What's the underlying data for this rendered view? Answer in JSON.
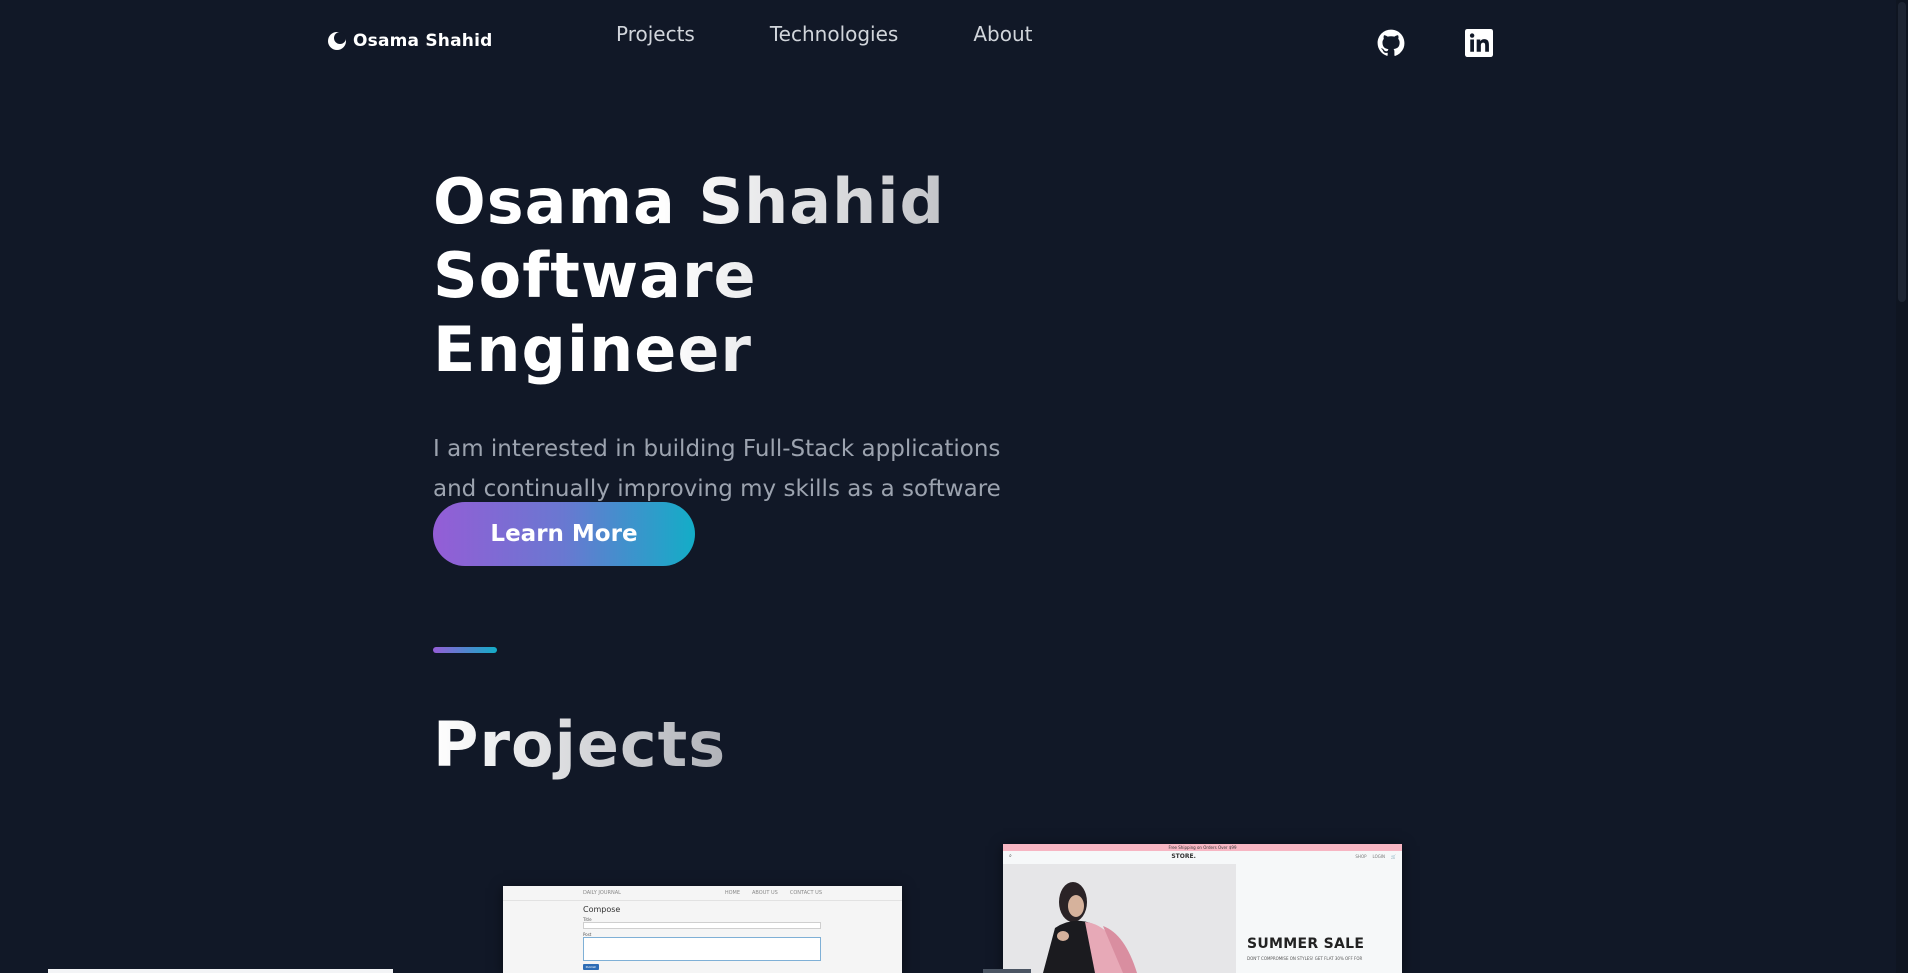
{
  "header": {
    "brand": "Osama Shahid",
    "nav": [
      "Projects",
      "Technologies",
      "About"
    ],
    "social": {
      "github_icon": "github-icon",
      "linkedin_icon": "linkedin-icon"
    }
  },
  "hero": {
    "title_line1": "Osama Shahid",
    "title_line2": "Software Engineer",
    "description": "I am interested in building Full-Stack applications and continually improving my skills as a software developer.",
    "button": "Learn More"
  },
  "projects": {
    "heading": "Projects",
    "cards": [
      {
        "site_name": "DAILY JOURNAL",
        "nav_links": [
          "HOME",
          "ABOUT US",
          "CONTACT US"
        ],
        "compose_title": "Compose",
        "field_title": "Title",
        "field_post": "Post",
        "publish": "Publish"
      },
      {
        "banner": "Free Shipping on Orders Over $99",
        "store_name": "STORE.",
        "nav_right": [
          "SHOP",
          "LOGIN",
          "CART"
        ],
        "sale": "SUMMER SALE",
        "sale_sub": "DON'T COMPROMISE ON STYLES! GET FLAT 30% OFF FOR"
      }
    ]
  },
  "colors": {
    "background": "#111827",
    "gradient_start": "#945dd6",
    "gradient_end": "#13adc7"
  }
}
